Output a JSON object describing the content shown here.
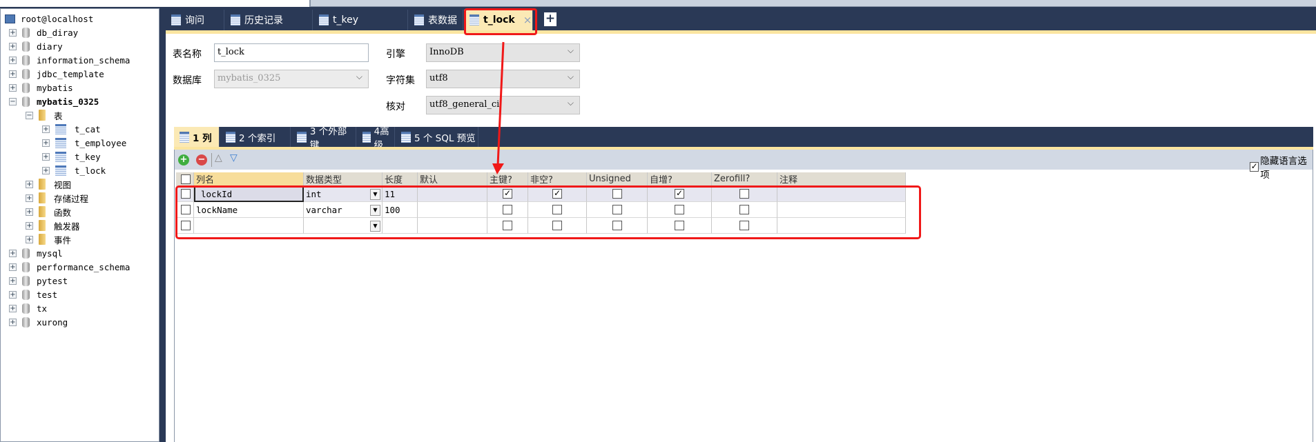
{
  "sidebar": {
    "root": "root@localhost",
    "databases_top": [
      "db_diray",
      "diary",
      "information_schema",
      "jdbc_template",
      "mybatis"
    ],
    "expanded_db": "mybatis_0325",
    "tables_folder": "表",
    "tables": [
      "t_cat",
      "t_employee",
      "t_key",
      "t_lock"
    ],
    "folders": [
      "视图",
      "存储过程",
      "函数",
      "触发器",
      "事件"
    ],
    "databases_bottom": [
      "mysql",
      "performance_schema",
      "pytest",
      "test",
      "tx",
      "xurong"
    ]
  },
  "main_tabs": [
    {
      "label": "询问"
    },
    {
      "label": "历史记录"
    },
    {
      "label": "t_key"
    },
    {
      "label": "表数据"
    },
    {
      "label": "t_lock",
      "active": true
    }
  ],
  "form": {
    "table_name_label": "表名称",
    "table_name": "t_lock",
    "database_label": "数据库",
    "database": "mybatis_0325",
    "engine_label": "引擎",
    "engine": "InnoDB",
    "charset_label": "字符集",
    "charset": "utf8",
    "collation_label": "核对",
    "collation": "utf8_general_ci"
  },
  "inner_tabs": [
    {
      "label": "1 列",
      "active": true
    },
    {
      "label": "2 个索引"
    },
    {
      "label": "3 个外部键"
    },
    {
      "label": "4高级"
    },
    {
      "label": "5 个 SQL 预览"
    }
  ],
  "toolbar": {
    "hide_lang_label": "隐藏语言选项",
    "hide_lang_checked": true
  },
  "grid": {
    "headers": [
      "列名",
      "数据类型",
      "长度",
      "默认",
      "主键?",
      "非空?",
      "Unsigned",
      "自增?",
      "Zerofill?",
      "注释"
    ],
    "rows": [
      {
        "name": "lockId",
        "type": "int",
        "length": "11",
        "default": "",
        "pk": true,
        "notnull": true,
        "unsigned": false,
        "ai": true,
        "zerofill": false,
        "comment": ""
      },
      {
        "name": "lockName",
        "type": "varchar",
        "length": "100",
        "default": "",
        "pk": false,
        "notnull": false,
        "unsigned": false,
        "ai": false,
        "zerofill": false,
        "comment": ""
      },
      {
        "name": "",
        "type": "",
        "length": "",
        "default": "",
        "pk": false,
        "notnull": false,
        "unsigned": false,
        "ai": false,
        "zerofill": false,
        "comment": ""
      }
    ]
  },
  "colors": {
    "header_bg": "#2a3956",
    "active_tab": "#fbe9b5",
    "annotation": "#ff0000"
  }
}
